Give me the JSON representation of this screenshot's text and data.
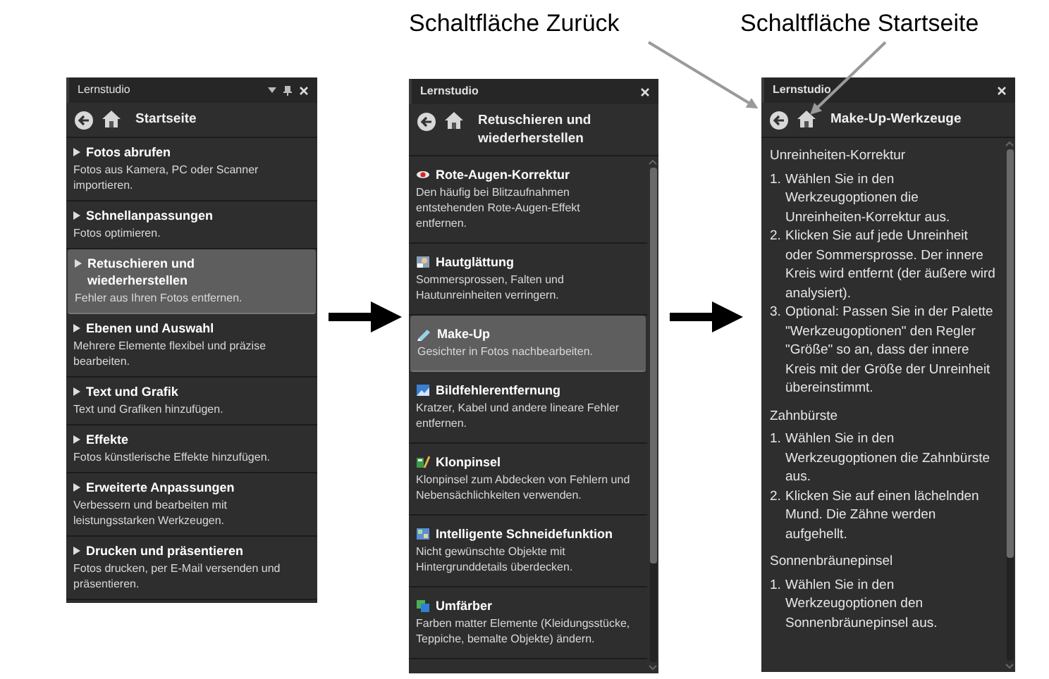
{
  "callouts": [
    {
      "text": "Schaltfläche Zurück"
    },
    {
      "text": "Schaltfläche Startseite"
    }
  ],
  "panels": [
    {
      "kind": "menu",
      "title": "Lernstudio",
      "title_bold": false,
      "show_pin": true,
      "heading": "Startseite",
      "items": [
        {
          "title": "Fotos abrufen",
          "description": "Fotos aus Kamera, PC oder Scanner importieren.",
          "selected": false
        },
        {
          "title": "Schnellanpassungen",
          "description": "Fotos optimieren.",
          "selected": false
        },
        {
          "title": "Retuschieren und wiederherstellen",
          "description": "Fehler aus Ihren Fotos entfernen.",
          "selected": true
        },
        {
          "title": "Ebenen und Auswahl",
          "description": "Mehrere Elemente flexibel und präzise bearbeiten.",
          "selected": false
        },
        {
          "title": "Text und Grafik",
          "description": "Text und Grafiken hinzufügen.",
          "selected": false
        },
        {
          "title": "Effekte",
          "description": "Fotos künstlerische Effekte hinzufügen.",
          "selected": false
        },
        {
          "title": "Erweiterte Anpassungen",
          "description": "Verbessern und bearbeiten mit leistungsstarken Werkzeugen.",
          "selected": false
        },
        {
          "title": "Drucken und präsentieren",
          "description": "Fotos drucken, per E-Mail versenden und präsentieren.",
          "selected": false
        }
      ]
    },
    {
      "kind": "tools",
      "title": "Lernstudio",
      "title_bold": true,
      "show_pin": false,
      "heading": "Retuschieren und wiederherstellen",
      "items": [
        {
          "title": "Rote-Augen-Korrektur",
          "description": "Den häufig bei Blitzaufnahmen entstehenden Rote-Augen-Effekt entfernen.",
          "selected": false
        },
        {
          "title": "Hautglättung",
          "description": "Sommersprossen, Falten und Hautunreinheiten verringern.",
          "selected": false
        },
        {
          "title": "Make-Up",
          "description": "Gesichter in Fotos nachbearbeiten.",
          "selected": true
        },
        {
          "title": "Bildfehlerentfernung",
          "description": "Kratzer, Kabel und andere lineare Fehler entfernen.",
          "selected": false
        },
        {
          "title": "Klonpinsel",
          "description": "Klonpinsel zum Abdecken von Fehlern und Nebensächlichkeiten verwenden.",
          "selected": false
        },
        {
          "title": "Intelligente Schneidefunktion",
          "description": "Nicht gewünschte Objekte mit Hintergrunddetails überdecken.",
          "selected": false
        },
        {
          "title": "Umfärber",
          "description": "Farben matter Elemente (Kleidungsstücke, Teppiche, bemalte Objekte) ändern.",
          "selected": false
        }
      ]
    },
    {
      "kind": "help",
      "title": "Lernstudio",
      "title_bold": true,
      "show_pin": false,
      "heading": "Make-Up-Werkzeuge",
      "sections": [
        {
          "heading": "Unreinheiten-Korrektur",
          "steps": [
            {
              "number": "1.",
              "text": "Wählen Sie in den Werkzeugoptionen die Unreinheiten-Korrektur aus."
            },
            {
              "number": "2.",
              "text": "Klicken Sie auf jede Unreinheit oder Sommersprosse. Der innere Kreis wird entfernt (der äußere wird analysiert)."
            },
            {
              "number": "3.",
              "text": "Optional: Passen Sie in der Palette \"Werkzeugoptionen\" den Regler \"Größe\" so an, dass der innere Kreis mit der Größe der Unreinheit übereinstimmt."
            }
          ]
        },
        {
          "heading": "Zahnbürste",
          "steps": [
            {
              "number": "1.",
              "text": "Wählen Sie in den Werkzeugoptionen die Zahnbürste aus."
            },
            {
              "number": "2.",
              "text": "Klicken Sie auf einen lächelnden Mund. Die Zähne werden aufgehellt."
            }
          ]
        },
        {
          "heading": "Sonnenbräunepinsel",
          "steps": [
            {
              "number": "1.",
              "text": "Wählen Sie in den Werkzeugoptionen den Sonnenbräunepinsel aus."
            }
          ]
        }
      ]
    }
  ]
}
